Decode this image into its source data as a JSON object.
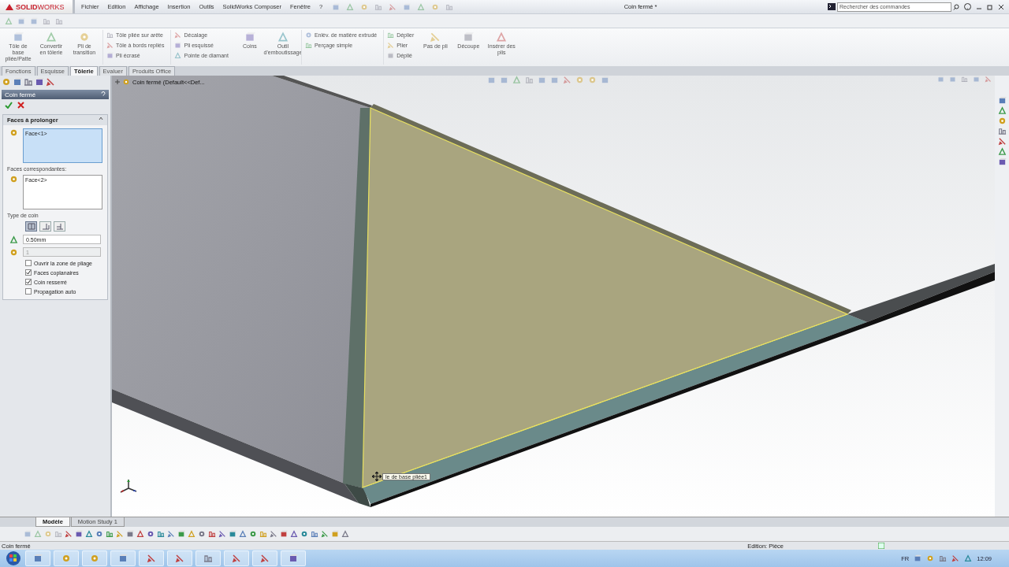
{
  "title_bar": {
    "logo": "**SOLID**WORKS",
    "menu": [
      "Fichier",
      "Edition",
      "Affichage",
      "Insertion",
      "Outils",
      "SolidWorks Composer",
      "Fenêtre",
      "?"
    ],
    "document_title": "Coin fermé *",
    "search": {
      "placeholder": "Rechercher des commandes"
    }
  },
  "ribbon": [
    {
      "kind": "large",
      "label": "Tôle de base pliée/Patte"
    },
    {
      "kind": "large",
      "label": "Convertir en tôlerie"
    },
    {
      "kind": "large",
      "label": "Pli de transition"
    },
    {
      "kind": "stack",
      "items": [
        "Tôle pliée sur arête",
        "Tôle à bords repliés",
        "Pli écrasé"
      ]
    },
    {
      "kind": "stack",
      "items": [
        "Décalage",
        "Pli esquissé",
        "Pointe de diamant"
      ]
    },
    {
      "kind": "large",
      "label": "Coins"
    },
    {
      "kind": "large",
      "label": "Outil d'emboutissage"
    },
    {
      "kind": "stack",
      "items": [
        "Enlèv. de matière extrudé",
        "Perçage simple"
      ]
    },
    {
      "kind": "stack",
      "items": [
        "Déplier",
        "Plier",
        "Déplié"
      ]
    },
    {
      "kind": "large",
      "label": "Pas de pli"
    },
    {
      "kind": "large",
      "label": "Découpe"
    },
    {
      "kind": "large",
      "label": "Insérer des plis"
    }
  ],
  "command_tabs": [
    {
      "label": "Fonctions",
      "selected": false
    },
    {
      "label": "Esquisse",
      "selected": false
    },
    {
      "label": "Tôlerie",
      "selected": true
    },
    {
      "label": "Evaluer",
      "selected": false
    },
    {
      "label": "Produits Office",
      "selected": false
    }
  ],
  "property_manager": {
    "title": "Coin fermé",
    "group_title": "Faces à prolonger",
    "faces_to_extend": {
      "items": [
        "Face<1>"
      ],
      "active": true
    },
    "matching_label": "Faces correspondantes:",
    "matching_faces": {
      "items": [
        "Face<2>"
      ],
      "active": false
    },
    "corner_type_label": "Type de coin",
    "corner_types": [
      {
        "selected": true
      },
      {
        "selected": false
      },
      {
        "selected": false
      }
    ],
    "fields": [
      {
        "value": "0.50mm",
        "disabled": false
      },
      {
        "value": "1",
        "disabled": true
      }
    ],
    "options": [
      {
        "label": "Ouvrir la zone de pliage",
        "checked": false
      },
      {
        "label": "Faces coplanaires",
        "checked": true
      },
      {
        "label": "Coin resserré",
        "checked": true
      },
      {
        "label": "Propagation auto",
        "checked": false
      }
    ]
  },
  "feature_tree": {
    "item": "Coin fermé  (Default<<Def..."
  },
  "tooltip": "le de base pliée1",
  "bottom_tabs": [
    {
      "label": "Modèle",
      "selected": true
    },
    {
      "label": "Motion Study 1",
      "selected": false
    }
  ],
  "status_bar": {
    "left": "Coin fermé",
    "right": "Edition: Pièce"
  },
  "taskbar": {
    "language": "FR",
    "time": "12:09"
  }
}
